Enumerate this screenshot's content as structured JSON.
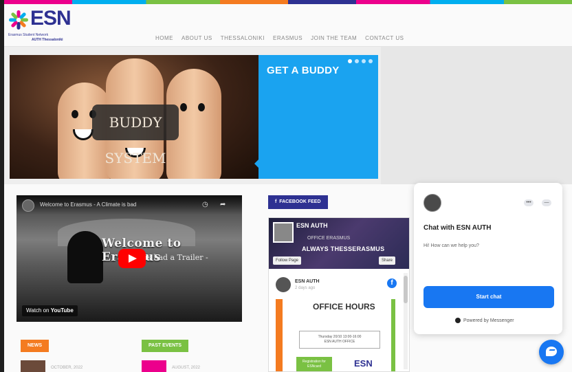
{
  "brand": {
    "name": "ESN",
    "subtitle": "Erasmus Student Network",
    "section": "AUTH Thessaloniki",
    "color": "#2e3192"
  },
  "nav": {
    "items": [
      {
        "label": "HOME"
      },
      {
        "label": "ABOUT US"
      },
      {
        "label": "THESSALONIKI"
      },
      {
        "label": "ERASMUS"
      },
      {
        "label": "JOIN THE TEAM"
      },
      {
        "label": "CONTACT US"
      }
    ]
  },
  "slider": {
    "image_label": "BUDDY SYSTEM",
    "panel_title": "GET A BUDDY",
    "panel_color": "#1aa3f0",
    "dots": 4,
    "active_dot": 1
  },
  "video": {
    "title": "Welcome to Erasmus - A Climate is bad",
    "heading": "Welcome to Erasmus",
    "subheading": "- Erasmus had a Trailer -",
    "watch_prefix": "Watch on",
    "watch_brand": "YouTube",
    "icons": [
      "clock-icon",
      "share-icon"
    ]
  },
  "sections": {
    "news_label": "NEWS",
    "news_color": "#f47b20",
    "events_label": "PAST EVENTS",
    "events_color": "#7ac143",
    "news_date": "OCTOBER, 2022",
    "events_date": "AUGUST, 2022"
  },
  "facebook": {
    "tab_label": "FACEBOOK FEED",
    "page_name": "ESN AUTH",
    "cover_line1": "OFFICE ERASMUS",
    "cover_line2": "ALWAYS THESSERASMUS",
    "follow_label": "Follow Page",
    "share_label": "Share",
    "post_name": "ESN AUTH",
    "post_time": "2 days ago",
    "poster_title": "OFFICE HOURS",
    "poster_line1": "Thursday 20/10 13:00-16:00",
    "poster_line2": "ESN AUTH OFFICE",
    "poster_green_1": "Registration for",
    "poster_green_2": "ESNcard",
    "poster_brand": "ESN"
  },
  "chat": {
    "title": "Chat with ESN AUTH",
    "subtitle": "Hi! How can we help you?",
    "button_label": "Start chat",
    "powered": "Powered by Messenger",
    "accent": "#1877f2",
    "ctrl_more": "•••",
    "ctrl_min": "—"
  }
}
